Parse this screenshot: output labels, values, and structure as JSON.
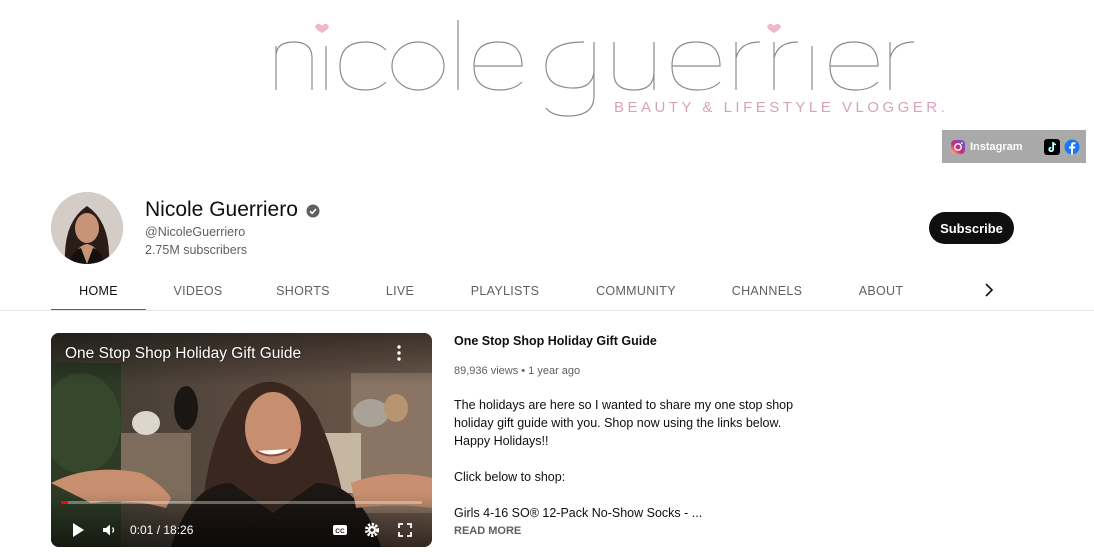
{
  "banner": {
    "logo_text": "nicole guerriero",
    "tagline": "BEAUTY & LIFESTYLE VLOGGER.",
    "social": {
      "instagram_label": "Instagram",
      "instagram_icon": "instagram-icon",
      "tiktok_icon": "tiktok-icon",
      "facebook_icon": "facebook-icon"
    }
  },
  "channel": {
    "name": "Nicole Guerriero",
    "verified_icon": "verified-check-icon",
    "handle": "@NicoleGuerriero",
    "subscribers": "2.75M subscribers",
    "subscribe_label": "Subscribe"
  },
  "tabs": [
    {
      "label": "HOME",
      "active": true
    },
    {
      "label": "VIDEOS",
      "active": false
    },
    {
      "label": "SHORTS",
      "active": false
    },
    {
      "label": "LIVE",
      "active": false
    },
    {
      "label": "PLAYLISTS",
      "active": false
    },
    {
      "label": "COMMUNITY",
      "active": false
    },
    {
      "label": "CHANNELS",
      "active": false
    },
    {
      "label": "ABOUT",
      "active": false
    }
  ],
  "featured": {
    "overlay_title": "One Stop Shop Holiday Gift Guide",
    "time": "0:01 / 18:26",
    "progress": 0.01,
    "title": "One Stop Shop Holiday Gift Guide",
    "meta": "89,936 views • 1 year ago",
    "description": [
      "The holidays are here so I wanted to share my one stop shop",
      "holiday gift guide with you. Shop now using the links below.",
      "Happy Holidays!!",
      "",
      "Click below to shop:",
      "",
      "Girls 4-16 SO® 12-Pack No-Show Socks - ..."
    ],
    "read_more": "READ MORE"
  },
  "colors": {
    "accent": "#0f0f0f",
    "secondary_text": "#606060",
    "progress": "#ff0000",
    "banner_pink": "#d8a2bd",
    "social_bar": "#a9a9a9"
  }
}
